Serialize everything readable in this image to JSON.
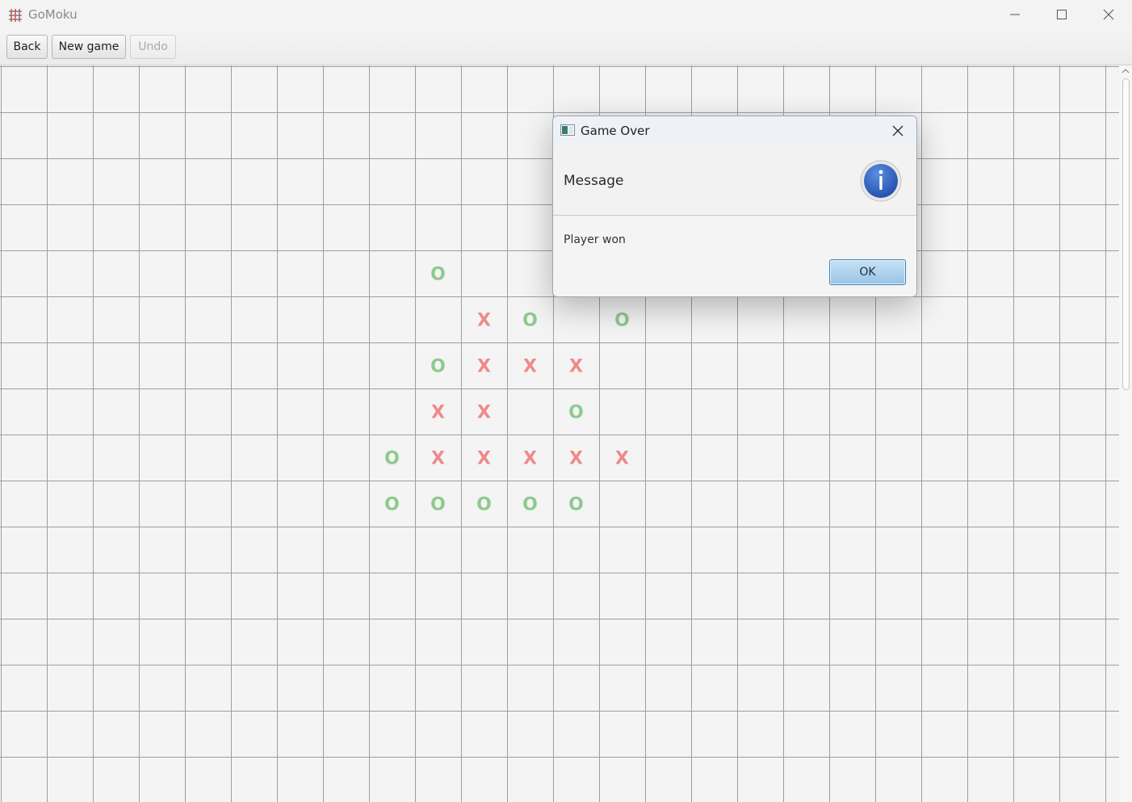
{
  "window": {
    "title": "GoMoku",
    "controls": [
      "minimize",
      "maximize",
      "close"
    ]
  },
  "toolbar": {
    "back_label": "Back",
    "new_game_label": "New game",
    "undo_label": "Undo",
    "undo_disabled": true
  },
  "board": {
    "grid_color": "#9e9e9e",
    "x_color": "#ee8a8a",
    "o_color": "#8fc98f",
    "pieces": [
      {
        "row": 4,
        "col": 9,
        "mark": "O"
      },
      {
        "row": 5,
        "col": 10,
        "mark": "X"
      },
      {
        "row": 5,
        "col": 11,
        "mark": "O"
      },
      {
        "row": 5,
        "col": 13,
        "mark": "O"
      },
      {
        "row": 6,
        "col": 9,
        "mark": "O"
      },
      {
        "row": 6,
        "col": 10,
        "mark": "X"
      },
      {
        "row": 6,
        "col": 11,
        "mark": "X"
      },
      {
        "row": 6,
        "col": 12,
        "mark": "X"
      },
      {
        "row": 7,
        "col": 9,
        "mark": "X"
      },
      {
        "row": 7,
        "col": 10,
        "mark": "X"
      },
      {
        "row": 7,
        "col": 12,
        "mark": "O"
      },
      {
        "row": 8,
        "col": 8,
        "mark": "O"
      },
      {
        "row": 8,
        "col": 9,
        "mark": "X"
      },
      {
        "row": 8,
        "col": 10,
        "mark": "X"
      },
      {
        "row": 8,
        "col": 11,
        "mark": "X"
      },
      {
        "row": 8,
        "col": 12,
        "mark": "X"
      },
      {
        "row": 8,
        "col": 13,
        "mark": "X"
      },
      {
        "row": 9,
        "col": 8,
        "mark": "O"
      },
      {
        "row": 9,
        "col": 9,
        "mark": "O"
      },
      {
        "row": 9,
        "col": 10,
        "mark": "O"
      },
      {
        "row": 9,
        "col": 11,
        "mark": "O"
      },
      {
        "row": 9,
        "col": 12,
        "mark": "O"
      }
    ]
  },
  "dialog": {
    "title": "Game Over",
    "header": "Message",
    "content": "Player won",
    "ok_label": "OK",
    "icon": "info-icon",
    "accent": "#2f63c2"
  }
}
